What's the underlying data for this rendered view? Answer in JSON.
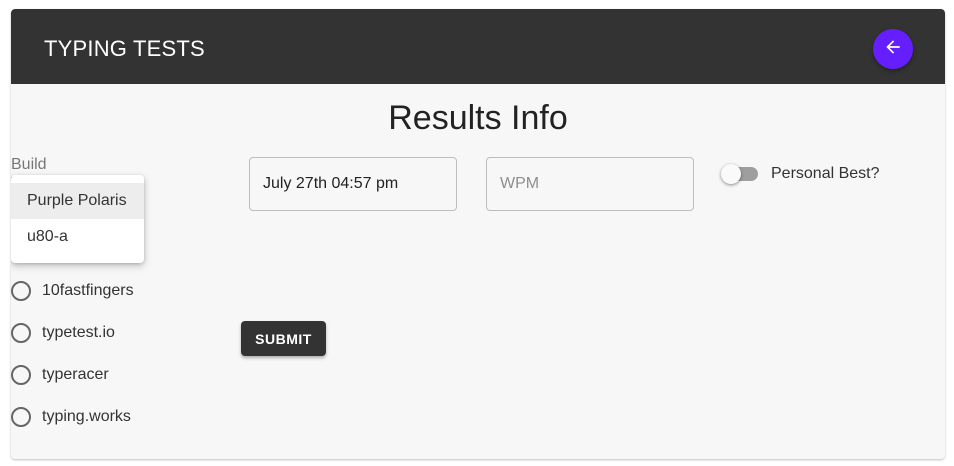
{
  "app": {
    "title": "TYPING TESTS",
    "back_icon": "arrow-left-icon",
    "accent_color": "#651fff",
    "bar_color": "#333333"
  },
  "page": {
    "title": "Results Info"
  },
  "build": {
    "label": "Build",
    "options": [
      {
        "label": "Purple Polaris",
        "highlighted": true
      },
      {
        "label": "u80-a",
        "highlighted": false
      }
    ]
  },
  "test_sites": [
    {
      "label": "10fastfingers",
      "checked": false
    },
    {
      "label": "typetest.io",
      "checked": false
    },
    {
      "label": "typeracer",
      "checked": false
    },
    {
      "label": "typing.works",
      "checked": false
    }
  ],
  "form": {
    "date_value": "July 27th 04:57 pm",
    "wpm_value": "",
    "wpm_placeholder": "WPM",
    "personal_best_label": "Personal Best?",
    "personal_best_on": false,
    "submit_label": "SUBMIT"
  }
}
